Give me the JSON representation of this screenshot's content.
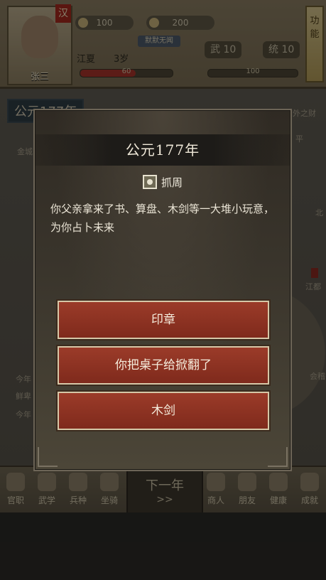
{
  "hud": {
    "han_badge": "汉",
    "portrait_name": "张三",
    "gold": "100",
    "copper": "200",
    "status_tag": "默默无闻",
    "location": "江夏",
    "age": "3岁",
    "hp_value": "60",
    "exp_value": "100",
    "wu_label": "武",
    "wu_value": "10",
    "tong_label": "统",
    "tong_value": "10",
    "function_button": "功能",
    "hp_fraction": 0.6,
    "exp_fraction": 0.0
  },
  "map": {
    "era_plaque": "公元177年",
    "right_label": "外之财",
    "labels": [
      "金城",
      "北",
      "江都",
      "会稽",
      "平"
    ],
    "news": [
      "今年",
      "鲜卑",
      "今年"
    ]
  },
  "bottom_nav": {
    "items": [
      "官职",
      "武学",
      "兵种",
      "坐骑",
      "商人",
      "朋友",
      "健康",
      "成就"
    ],
    "next_year": "下一年",
    "next_arrow": ">>"
  },
  "dialog": {
    "title": "公元177年",
    "event_name": "抓周",
    "event_text": "你父亲拿来了书、算盘、木剑等一大堆小玩意，为你占卜未来",
    "choices": [
      "印章",
      "你把桌子给掀翻了",
      "木剑"
    ]
  },
  "colors": {
    "choice_button": "#8b3323",
    "dialog_bg": "#35302a",
    "title_band": "#1d1b18",
    "text": "#ebe5d6"
  },
  "icons": {
    "event_icon": "zhuazhou-event-icon",
    "gold_icon": "gold-ingot-icon",
    "copper_icon": "copper-coin-icon"
  }
}
